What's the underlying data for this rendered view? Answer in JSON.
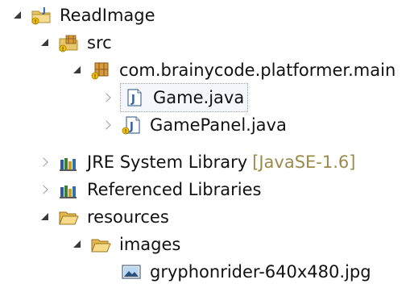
{
  "project_explorer": {
    "items": [
      {
        "label": "ReadImage",
        "icon": "java-project-icon",
        "expanded": true
      },
      {
        "label": "src",
        "icon": "source-folder-icon",
        "expanded": true
      },
      {
        "label": "com.brainycode.platformer.main",
        "icon": "package-icon",
        "expanded": true
      },
      {
        "label": "Game.java",
        "icon": "java-file-icon",
        "expanded": false,
        "selected": true
      },
      {
        "label": "GamePanel.java",
        "icon": "java-file-warning-icon",
        "expanded": false
      },
      {
        "label": "JRE System Library",
        "decoration": "[JavaSE-1.6]",
        "icon": "library-icon",
        "expanded": false
      },
      {
        "label": "Referenced Libraries",
        "icon": "library-icon",
        "expanded": false
      },
      {
        "label": "resources",
        "icon": "folder-open-icon",
        "expanded": true
      },
      {
        "label": "images",
        "icon": "folder-open-icon",
        "expanded": true
      },
      {
        "label": "gryphonrider-640x480.jpg",
        "icon": "image-file-icon"
      }
    ]
  }
}
